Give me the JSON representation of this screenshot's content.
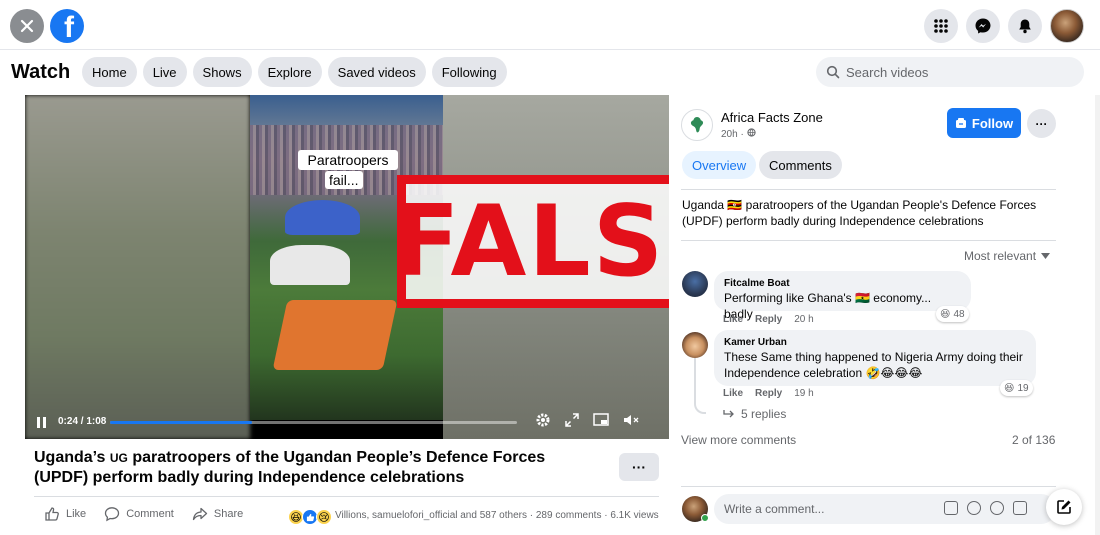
{
  "watch": {
    "title": "Watch",
    "nav": [
      "Home",
      "Live",
      "Shows",
      "Explore",
      "Saved videos",
      "Following"
    ],
    "search_placeholder": "Search videos"
  },
  "video": {
    "caption_line1": "Paratroopers",
    "caption_line2": "fail...",
    "stamp": "FALSE",
    "time": "0:24 / 1:08",
    "progress": 0.35
  },
  "post": {
    "title_prefix": "Uganda’s ",
    "title_flag": "UG",
    "title_rest": " paratroopers of the Ugandan People’s Defence Forces (UPDF) perform badly during Independence celebrations",
    "like": "Like",
    "comment": "Comment",
    "share": "Share",
    "reactions_text": "Villions, samuelofori_official and 587 others · 289 comments · 6.1K views"
  },
  "page": {
    "name": "Africa Facts Zone",
    "meta": "20h · ",
    "follow": "Follow",
    "tabs": [
      "Overview",
      "Comments"
    ],
    "description": "Uganda 🇺🇬 paratroopers of the Ugandan People's Defence Forces (UPDF) perform badly during Independence celebrations",
    "sort": "Most relevant"
  },
  "comments": [
    {
      "name": "Fitcalme Boat",
      "text": "Performing like Ghana's 🇬🇭 economy... badly",
      "like": "Like",
      "reply": "Reply",
      "time": "20 h",
      "react_count": "48"
    },
    {
      "name": "Kamer Urban",
      "text": "These Same thing happened to Nigeria Army doing their Independence celebration 🤣😂😂😂",
      "like": "Like",
      "reply": "Reply",
      "time": "19 h",
      "react_count": "19",
      "replies": "5 replies"
    }
  ],
  "view_more": "View more comments",
  "count": "2 of 136",
  "write_comment": "Write a comment...",
  "colors": {
    "brand": "#1877f2",
    "stamp": "#e3101a"
  }
}
